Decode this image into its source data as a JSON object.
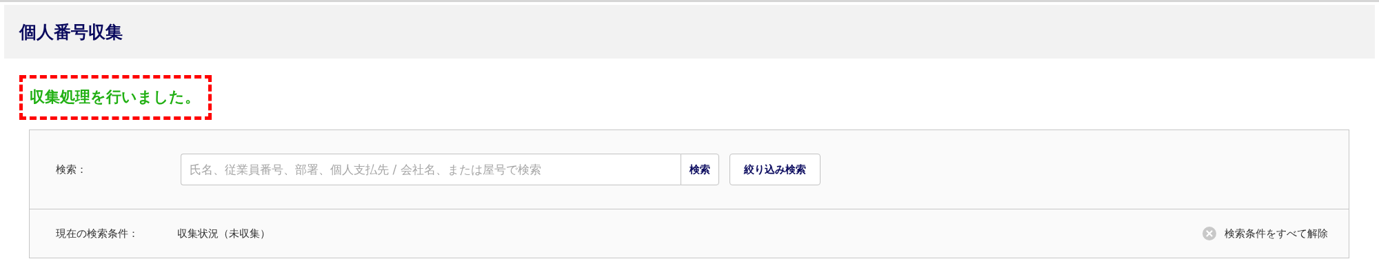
{
  "page": {
    "title": "個人番号収集"
  },
  "message": {
    "text": "収集処理を行いました。"
  },
  "search": {
    "label": "検索：",
    "placeholder": "氏名、従業員番号、部署、個人支払先 / 会社名、または屋号で検索",
    "search_button": "検索",
    "filter_button": "絞り込み検索"
  },
  "conditions": {
    "label": "現在の検索条件：",
    "value": "収集状況（未収集）",
    "clear_button": "検索条件をすべて解除"
  }
}
